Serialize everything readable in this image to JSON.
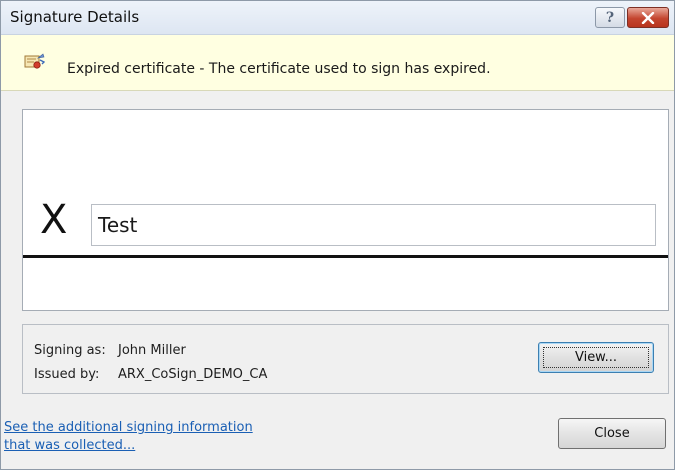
{
  "window": {
    "title": "Signature Details"
  },
  "infobar": {
    "icon": "expired-certificate-icon",
    "message": "Expired certificate - The certificate used to sign has expired."
  },
  "signature": {
    "x_mark": "X",
    "name": "Test"
  },
  "details": {
    "signing_as_label": "Signing as:",
    "signing_as_value": "John Miller",
    "issued_by_label": "Issued by:",
    "issued_by_value": "ARX_CoSign_DEMO_CA",
    "view_button": "View..."
  },
  "footer": {
    "link_line1": "See the additional signing information",
    "link_line2": "that was collected...",
    "close_button": "Close"
  },
  "colors": {
    "infobar_bg": "#ffffe1",
    "link": "#1a5fb4",
    "close_caption": "#c4452f"
  }
}
